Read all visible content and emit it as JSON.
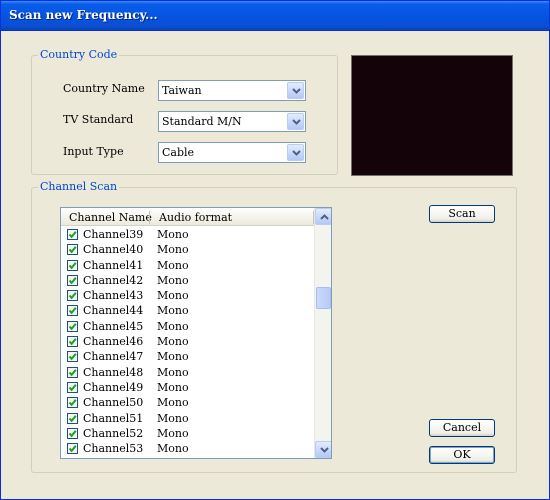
{
  "window": {
    "title": "Scan new Frequency..."
  },
  "country_code": {
    "legend": "Country Code",
    "country_name": {
      "label": "Country Name",
      "value": "Taiwan"
    },
    "tv_standard": {
      "label": "TV Standard",
      "value": "Standard M/N"
    },
    "input_type": {
      "label": "Input Type",
      "value": "Cable"
    }
  },
  "channel_scan": {
    "legend": "Channel Scan",
    "columns": {
      "name": "Channel Name",
      "audio": "Audio format"
    },
    "rows": [
      {
        "name": "Channel39",
        "audio": "Mono",
        "checked": true
      },
      {
        "name": "Channel40",
        "audio": "Mono",
        "checked": true
      },
      {
        "name": "Channel41",
        "audio": "Mono",
        "checked": true
      },
      {
        "name": "Channel42",
        "audio": "Mono",
        "checked": true
      },
      {
        "name": "Channel43",
        "audio": "Mono",
        "checked": true
      },
      {
        "name": "Channel44",
        "audio": "Mono",
        "checked": true
      },
      {
        "name": "Channel45",
        "audio": "Mono",
        "checked": true
      },
      {
        "name": "Channel46",
        "audio": "Mono",
        "checked": true
      },
      {
        "name": "Channel47",
        "audio": "Mono",
        "checked": true
      },
      {
        "name": "Channel48",
        "audio": "Mono",
        "checked": true
      },
      {
        "name": "Channel49",
        "audio": "Mono",
        "checked": true
      },
      {
        "name": "Channel50",
        "audio": "Mono",
        "checked": true
      },
      {
        "name": "Channel51",
        "audio": "Mono",
        "checked": true
      },
      {
        "name": "Channel52",
        "audio": "Mono",
        "checked": true
      },
      {
        "name": "Channel53",
        "audio": "Mono",
        "checked": true
      }
    ]
  },
  "buttons": {
    "scan": "Scan",
    "cancel": "Cancel",
    "ok": "OK"
  },
  "icons": {
    "combo_arrow": "chevron-down-icon",
    "scroll_up": "chevron-up-icon",
    "scroll_down": "chevron-down-icon",
    "checkbox": "checkmark-icon"
  },
  "colors": {
    "title_bar": "#0554e3",
    "group_legend": "#0046d5",
    "dialog_bg": "#ece9d8",
    "preview_bg": "#140308",
    "checkmark": "#21a121"
  }
}
